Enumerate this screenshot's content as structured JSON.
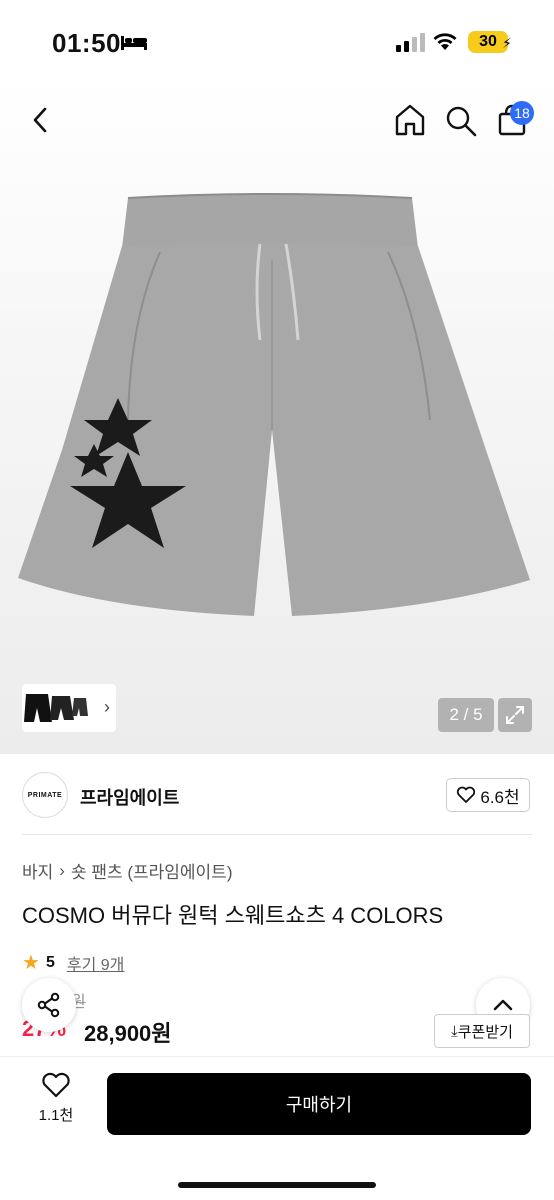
{
  "status_bar": {
    "time": "01:50",
    "battery": "30"
  },
  "header": {
    "cart_count": "18"
  },
  "gallery": {
    "counter": "2 / 5"
  },
  "brand": {
    "logo_text": "PRIMATE",
    "name": "프라임에이트",
    "like_count": "6.6천"
  },
  "breadcrumb": {
    "items": [
      "바지",
      "숏 팬츠 (프라임에이트)"
    ]
  },
  "product": {
    "title": "COSMO 버뮤다 원턱 스웨트쇼츠 4 COLORS",
    "rating": "5",
    "review_link": "후기 9개",
    "original_price": "39,600원",
    "discount_rate": "27%",
    "sale_price": "28,900원",
    "coupon_label": "쿠폰받기"
  },
  "bottom_bar": {
    "wish_count": "1.1천",
    "buy_label": "구매하기"
  },
  "colors": {
    "accent_blue": "#2f6cf6",
    "discount_red": "#f4244b",
    "rating_star": "#f5a623",
    "buy_button": "#000000"
  }
}
